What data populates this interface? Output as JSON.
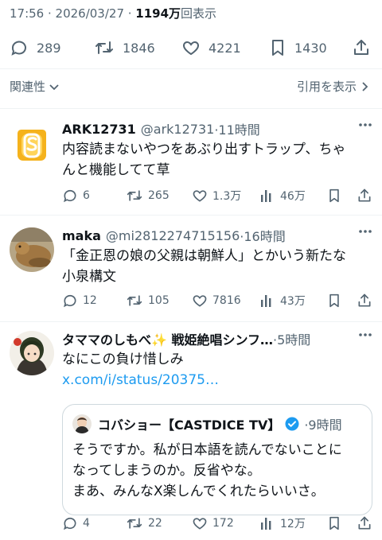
{
  "post_meta": {
    "time_date": "17:56 · 2026/03/27 · ",
    "views_count": "1194万",
    "views_label": "回表示"
  },
  "post_stats": {
    "replies": "289",
    "reposts": "1846",
    "likes": "4221",
    "bookmarks": "1430"
  },
  "sort": {
    "label": "関連性",
    "quotes_link": "引用を表示"
  },
  "replies": [
    {
      "name": "ARK12731",
      "handle": "@ark12731",
      "time": "·11時間",
      "text_lines": [
        "内容読まないやつをあぶり出すトラップ、ちゃ",
        "んと機能してて草"
      ],
      "replies": "6",
      "reposts": "265",
      "likes": "1.3万",
      "views": "46万"
    },
    {
      "name": "maka",
      "handle": "@mi2812274715156",
      "time": "·16時間",
      "text_lines": [
        "「金正恩の娘の父親は朝鮮人」とかいう新たな",
        "小泉構文"
      ],
      "replies": "12",
      "reposts": "105",
      "likes": "7816",
      "views": "43万"
    },
    {
      "name": "タママのしもべ✨ 戦姫絶唱シンフ…",
      "handle": "",
      "time": "·5時間",
      "text_lines": [
        "なにこの負け惜しみ",
        "x.com/i/status/20375…"
      ],
      "replies": "4",
      "reposts": "22",
      "likes": "172",
      "views": "12万",
      "quote": {
        "name": "コバショー【CASTDICE TV】",
        "time": "·9時間",
        "text_lines": [
          "そうですか。私が日本語を読んでないことに",
          "なってしまうのか。反省やな。",
          "まあ、みんなX楽しんでくれたらいいさ。"
        ]
      }
    }
  ],
  "colors": {
    "text": "#0f1419",
    "muted": "#536471",
    "link": "#1d9bf0",
    "separator": "#eff3f4",
    "verified": "#1d9bf0",
    "ark_avatar": "#f5b21c"
  }
}
